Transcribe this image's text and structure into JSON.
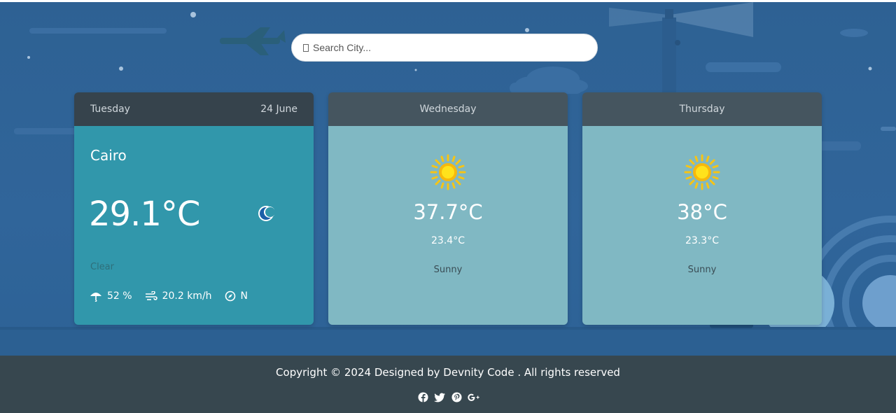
{
  "search": {
    "placeholder": "Search City..."
  },
  "today": {
    "day": "Tuesday",
    "date": "24 June",
    "city": "Cairo",
    "temperature": "29.1°C",
    "condition": "Clear",
    "condition_icon": "moon-icon",
    "humidity": "52 %",
    "wind_speed": "20.2 km/h",
    "wind_direction": "N"
  },
  "forecast": [
    {
      "day": "Wednesday",
      "max_temp": "37.7°C",
      "min_temp": "23.4°C",
      "condition": "Sunny",
      "icon": "sun-icon"
    },
    {
      "day": "Thursday",
      "max_temp": "38°C",
      "min_temp": "23.3°C",
      "condition": "Sunny",
      "icon": "sun-icon"
    }
  ],
  "footer": {
    "copyright": "Copyright © 2024 Designed by Devnity Code . All rights reserved",
    "social": [
      "facebook-icon",
      "twitter-icon",
      "pinterest-icon",
      "google-plus-icon"
    ]
  },
  "colors": {
    "background": "#2f6396",
    "today_header": "#36434c",
    "today_body": "#3197ab",
    "forecast_header": "#45555f",
    "forecast_body": "#80b8c3",
    "footer": "#37474f",
    "sun": "#f6c416"
  }
}
